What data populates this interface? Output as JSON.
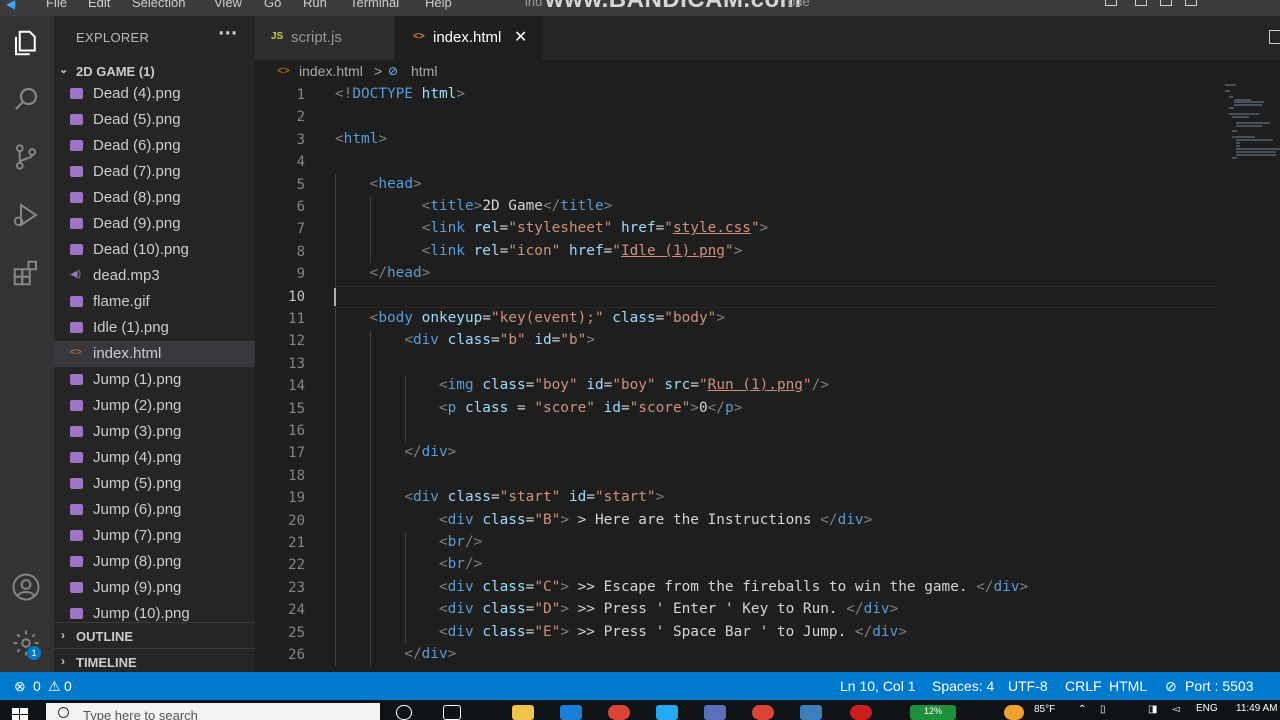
{
  "titlebar": {
    "menu": [
      "File",
      "Edit",
      "Selection",
      "View",
      "Go",
      "Run",
      "Terminal",
      "Help"
    ],
    "window_title_fragment": "ind",
    "window_title_suffix": "ode",
    "watermark": "www.BANDICAM.com"
  },
  "explorer": {
    "header": "EXPLORER",
    "more_label": "···",
    "folder_name": "2D GAME (1)",
    "files": [
      {
        "name": "Dead (4).png",
        "type": "image"
      },
      {
        "name": "Dead (5).png",
        "type": "image"
      },
      {
        "name": "Dead (6).png",
        "type": "image"
      },
      {
        "name": "Dead (7).png",
        "type": "image"
      },
      {
        "name": "Dead (8).png",
        "type": "image"
      },
      {
        "name": "Dead (9).png",
        "type": "image"
      },
      {
        "name": "Dead (10).png",
        "type": "image"
      },
      {
        "name": "dead.mp3",
        "type": "audio"
      },
      {
        "name": "flame.gif",
        "type": "image"
      },
      {
        "name": "Idle (1).png",
        "type": "image"
      },
      {
        "name": "index.html",
        "type": "html",
        "selected": true
      },
      {
        "name": "Jump (1).png",
        "type": "image"
      },
      {
        "name": "Jump (2).png",
        "type": "image"
      },
      {
        "name": "Jump (3).png",
        "type": "image"
      },
      {
        "name": "Jump (4).png",
        "type": "image"
      },
      {
        "name": "Jump (5).png",
        "type": "image"
      },
      {
        "name": "Jump (6).png",
        "type": "image"
      },
      {
        "name": "Jump (7).png",
        "type": "image"
      },
      {
        "name": "Jump (8).png",
        "type": "image"
      },
      {
        "name": "Jump (9).png",
        "type": "image"
      },
      {
        "name": "Jump (10).png",
        "type": "image"
      }
    ],
    "outline_label": "OUTLINE",
    "timeline_label": "TIMELINE"
  },
  "tabs": [
    {
      "icon": "JS",
      "label": "script.js",
      "active": false
    },
    {
      "icon": "<>",
      "label": "index.html",
      "active": true,
      "close": "✕"
    }
  ],
  "breadcrumb": {
    "file": "index.html",
    "separator": ">",
    "symbol": "html"
  },
  "editor": {
    "current_line": 10,
    "lines": [
      [
        [
          "pun",
          "<!"
        ],
        [
          "doc",
          "DOCTYPE"
        ],
        [
          "txt",
          " "
        ],
        [
          "attr",
          "html"
        ],
        [
          "pun",
          ">"
        ]
      ],
      [],
      [
        [
          "pun",
          "<"
        ],
        [
          "tag",
          "html"
        ],
        [
          "pun",
          ">"
        ]
      ],
      [],
      [
        [
          "txt",
          "    "
        ],
        [
          "pun",
          "<"
        ],
        [
          "tag",
          "head"
        ],
        [
          "pun",
          ">"
        ]
      ],
      [
        [
          "txt",
          "          "
        ],
        [
          "pun",
          "<"
        ],
        [
          "tag",
          "title"
        ],
        [
          "pun",
          ">"
        ],
        [
          "txt",
          "2D Game"
        ],
        [
          "pun",
          "</"
        ],
        [
          "tag",
          "title"
        ],
        [
          "pun",
          ">"
        ]
      ],
      [
        [
          "txt",
          "          "
        ],
        [
          "pun",
          "<"
        ],
        [
          "tag",
          "link"
        ],
        [
          "txt",
          " "
        ],
        [
          "attr",
          "rel"
        ],
        [
          "txt",
          "="
        ],
        [
          "str",
          "\"stylesheet\""
        ],
        [
          "txt",
          " "
        ],
        [
          "attr",
          "href"
        ],
        [
          "txt",
          "="
        ],
        [
          "str",
          "\""
        ],
        [
          "link",
          "style.css"
        ],
        [
          "str",
          "\""
        ],
        [
          "pun",
          ">"
        ]
      ],
      [
        [
          "txt",
          "          "
        ],
        [
          "pun",
          "<"
        ],
        [
          "tag",
          "link"
        ],
        [
          "txt",
          " "
        ],
        [
          "attr",
          "rel"
        ],
        [
          "txt",
          "="
        ],
        [
          "str",
          "\"icon\""
        ],
        [
          "txt",
          " "
        ],
        [
          "attr",
          "href"
        ],
        [
          "txt",
          "="
        ],
        [
          "str",
          "\""
        ],
        [
          "link",
          "Idle (1).png"
        ],
        [
          "str",
          "\""
        ],
        [
          "pun",
          ">"
        ]
      ],
      [
        [
          "txt",
          "    "
        ],
        [
          "pun",
          "</"
        ],
        [
          "tag",
          "head"
        ],
        [
          "pun",
          ">"
        ]
      ],
      [],
      [
        [
          "txt",
          "    "
        ],
        [
          "pun",
          "<"
        ],
        [
          "tag",
          "body"
        ],
        [
          "txt",
          " "
        ],
        [
          "attr",
          "onkeyup"
        ],
        [
          "txt",
          "="
        ],
        [
          "str",
          "\"key(event);\""
        ],
        [
          "txt",
          " "
        ],
        [
          "attr",
          "class"
        ],
        [
          "txt",
          "="
        ],
        [
          "str",
          "\"body\""
        ],
        [
          "pun",
          ">"
        ]
      ],
      [
        [
          "txt",
          "        "
        ],
        [
          "pun",
          "<"
        ],
        [
          "tag",
          "div"
        ],
        [
          "txt",
          " "
        ],
        [
          "attr",
          "class"
        ],
        [
          "txt",
          "="
        ],
        [
          "str",
          "\"b\""
        ],
        [
          "txt",
          " "
        ],
        [
          "attr",
          "id"
        ],
        [
          "txt",
          "="
        ],
        [
          "str",
          "\"b\""
        ],
        [
          "pun",
          ">"
        ]
      ],
      [],
      [
        [
          "txt",
          "            "
        ],
        [
          "pun",
          "<"
        ],
        [
          "tag",
          "img"
        ],
        [
          "txt",
          " "
        ],
        [
          "attr",
          "class"
        ],
        [
          "txt",
          "="
        ],
        [
          "str",
          "\"boy\""
        ],
        [
          "txt",
          " "
        ],
        [
          "attr",
          "id"
        ],
        [
          "txt",
          "="
        ],
        [
          "str",
          "\"boy\""
        ],
        [
          "txt",
          " "
        ],
        [
          "attr",
          "src"
        ],
        [
          "txt",
          "="
        ],
        [
          "str",
          "\""
        ],
        [
          "link",
          "Run (1).png"
        ],
        [
          "str",
          "\""
        ],
        [
          "pun",
          "/>"
        ]
      ],
      [
        [
          "txt",
          "            "
        ],
        [
          "pun",
          "<"
        ],
        [
          "tag",
          "p"
        ],
        [
          "txt",
          " "
        ],
        [
          "attr",
          "class"
        ],
        [
          "txt",
          " = "
        ],
        [
          "str",
          "\"score\""
        ],
        [
          "txt",
          " "
        ],
        [
          "attr",
          "id"
        ],
        [
          "txt",
          "="
        ],
        [
          "str",
          "\"score\""
        ],
        [
          "pun",
          ">"
        ],
        [
          "txt",
          "0"
        ],
        [
          "pun",
          "</"
        ],
        [
          "tag",
          "p"
        ],
        [
          "pun",
          ">"
        ]
      ],
      [],
      [
        [
          "txt",
          "        "
        ],
        [
          "pun",
          "</"
        ],
        [
          "tag",
          "div"
        ],
        [
          "pun",
          ">"
        ]
      ],
      [],
      [
        [
          "txt",
          "        "
        ],
        [
          "pun",
          "<"
        ],
        [
          "tag",
          "div"
        ],
        [
          "txt",
          " "
        ],
        [
          "attr",
          "class"
        ],
        [
          "txt",
          "="
        ],
        [
          "str",
          "\"start\""
        ],
        [
          "txt",
          " "
        ],
        [
          "attr",
          "id"
        ],
        [
          "txt",
          "="
        ],
        [
          "str",
          "\"start\""
        ],
        [
          "pun",
          ">"
        ]
      ],
      [
        [
          "txt",
          "            "
        ],
        [
          "pun",
          "<"
        ],
        [
          "tag",
          "div"
        ],
        [
          "txt",
          " "
        ],
        [
          "attr",
          "class"
        ],
        [
          "txt",
          "="
        ],
        [
          "str",
          "\"B\""
        ],
        [
          "pun",
          ">"
        ],
        [
          "txt",
          " > Here are the Instructions "
        ],
        [
          "pun",
          "</"
        ],
        [
          "tag",
          "div"
        ],
        [
          "pun",
          ">"
        ]
      ],
      [
        [
          "txt",
          "            "
        ],
        [
          "pun",
          "<"
        ],
        [
          "tag",
          "br"
        ],
        [
          "pun",
          "/>"
        ]
      ],
      [
        [
          "txt",
          "            "
        ],
        [
          "pun",
          "<"
        ],
        [
          "tag",
          "br"
        ],
        [
          "pun",
          "/>"
        ]
      ],
      [
        [
          "txt",
          "            "
        ],
        [
          "pun",
          "<"
        ],
        [
          "tag",
          "div"
        ],
        [
          "txt",
          " "
        ],
        [
          "attr",
          "class"
        ],
        [
          "txt",
          "="
        ],
        [
          "str",
          "\"C\""
        ],
        [
          "pun",
          ">"
        ],
        [
          "txt",
          " >> Escape from the fireballs to win the game. "
        ],
        [
          "pun",
          "</"
        ],
        [
          "tag",
          "div"
        ],
        [
          "pun",
          ">"
        ]
      ],
      [
        [
          "txt",
          "            "
        ],
        [
          "pun",
          "<"
        ],
        [
          "tag",
          "div"
        ],
        [
          "txt",
          " "
        ],
        [
          "attr",
          "class"
        ],
        [
          "txt",
          "="
        ],
        [
          "str",
          "\"D\""
        ],
        [
          "pun",
          ">"
        ],
        [
          "txt",
          " >> Press ' Enter ' Key to Run. "
        ],
        [
          "pun",
          "</"
        ],
        [
          "tag",
          "div"
        ],
        [
          "pun",
          ">"
        ]
      ],
      [
        [
          "txt",
          "            "
        ],
        [
          "pun",
          "<"
        ],
        [
          "tag",
          "div"
        ],
        [
          "txt",
          " "
        ],
        [
          "attr",
          "class"
        ],
        [
          "txt",
          "="
        ],
        [
          "str",
          "\"E\""
        ],
        [
          "pun",
          ">"
        ],
        [
          "txt",
          " >> Press ' Space Bar ' to Jump. "
        ],
        [
          "pun",
          "</"
        ],
        [
          "tag",
          "div"
        ],
        [
          "pun",
          ">"
        ]
      ],
      [
        [
          "txt",
          "        "
        ],
        [
          "pun",
          "</"
        ],
        [
          "tag",
          "div"
        ],
        [
          "pun",
          ">"
        ]
      ]
    ]
  },
  "statusbar": {
    "errors": "0",
    "warnings": "0",
    "position": "Ln 10, Col 1",
    "spaces": "Spaces: 4",
    "encoding": "UTF-8",
    "eol": "CRLF",
    "language": "HTML",
    "port": "Port : 5503"
  },
  "taskbar": {
    "search_placeholder": "Type here to search",
    "temperature": "85°F",
    "language": "ENG",
    "time": "11:49 AM",
    "battery_text": "12%"
  },
  "colors": {
    "statusbar": "#007acc",
    "editor_bg": "#1e1e1e",
    "sidebar_bg": "#252526",
    "activitybar_bg": "#333333",
    "tag": "#569cd6",
    "attr": "#9cdcfe",
    "string": "#ce9178"
  }
}
